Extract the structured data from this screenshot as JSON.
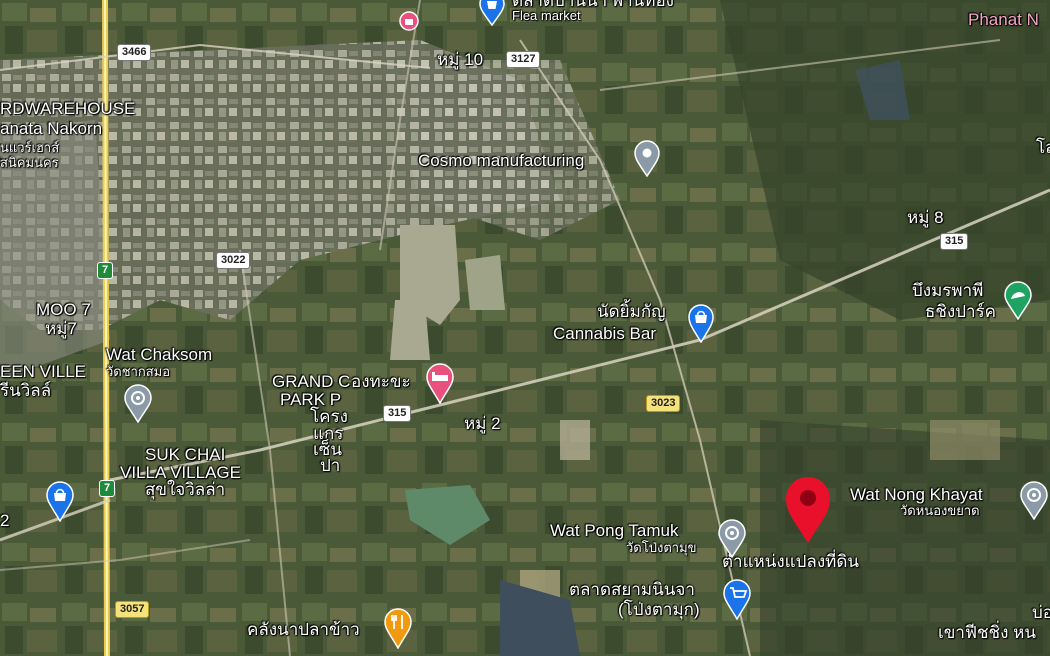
{
  "labels": {
    "flea_thai": "ตลาดบ้านนา พานทอง",
    "flea_en": "Flea market",
    "phanat": "Phanat N",
    "moo10": "หมู่ 10",
    "warehouse1": "RDWAREHOUSE",
    "warehouse2": "anata Nakorn",
    "warehouse3": "นแวร์เฮาส์",
    "warehouse4": "ัสนิคมนคร",
    "cosmo": "Cosmo manufacturing",
    "moo8": "หมู่ 8",
    "nudyim": "นัดยิ้มกัญ",
    "cannabis": "Cannabis Bar",
    "bueng1": "บึงมรพาพี",
    "bueng2": "ธชิงปาร์ค",
    "moo7a": "MOO 7",
    "moo7b": "หมู่7",
    "chaksom": "Wat Chaksom",
    "chaksom_th": "วัดชากสมอ",
    "greenville1": "EEN VILLE",
    "greenville2": "รีนวิลล์",
    "grand1": "GRAND C",
    "grand2": "PARK P",
    "grand3": "โครง",
    "grand4": "แกร",
    "grand5": "เซ็น",
    "grand6": "ปา",
    "hotel": "องทะขะ",
    "moo2": "หมู่ 2",
    "sukchai1": "SUK CHAI",
    "sukchai2": "VILLA VILLAGE",
    "sukchai3": "สุขใจวิลล่า",
    "nongkhayat": "Wat Nong Khayat",
    "nongkhayat_th": "วัดหนองขยาด",
    "pongtamuk": "Wat Pong Tamuk",
    "pongtamuk_th": "วัดโป่งตามุข",
    "plot": "ตำแหน่งแปลงที่ดิน",
    "siam1": "ตลาดสยามนินจา",
    "siam2": "(โป่งตามุก)",
    "khlang": "คลังนาปลาข้าว",
    "khao1": "บ่อ",
    "khao2": "เขาฟีชชิ่ง หน",
    "edge_lo": "โล",
    "edge_2": "2"
  },
  "shields": {
    "r3466": "3466",
    "r3127": "3127",
    "r3022": "3022",
    "r315a": "315",
    "r315b": "315",
    "r3023": "3023",
    "r3057": "3057",
    "r7a": "7",
    "r7b": "7"
  },
  "colors": {
    "pin_red": "#e8102a",
    "pin_blue": "#1a73e8",
    "pin_gray": "#8a9aa6",
    "pin_pink": "#e8517e",
    "pin_orange": "#f29a0f",
    "pin_green": "#1ea362"
  }
}
